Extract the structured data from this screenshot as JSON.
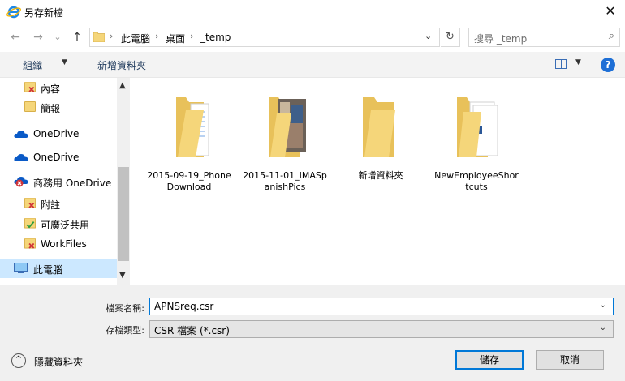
{
  "window": {
    "title": "另存新檔",
    "close": "✕"
  },
  "nav": {
    "back": "←",
    "forward": "→",
    "recent": "⌄",
    "up": "↑",
    "crumbs": [
      "此電腦",
      "桌面",
      "_temp"
    ],
    "crumb_sep": "›",
    "refresh": "↻",
    "search_placeholder": "搜尋 _temp",
    "search_icon": "⌕"
  },
  "toolbar": {
    "organize": "組織",
    "new_folder": "新增資料夾",
    "help": "?"
  },
  "sidebar": {
    "items": [
      {
        "label": "內容",
        "icon": "folder-error-icon"
      },
      {
        "label": "簡報",
        "icon": "folder-icon"
      },
      {
        "label": "OneDrive",
        "icon": "onedrive-icon"
      },
      {
        "label": "OneDrive",
        "icon": "onedrive-icon"
      },
      {
        "label": "商務用 OneDrive",
        "icon": "onedrive-business-error-icon"
      },
      {
        "label": "附註",
        "icon": "folder-error-icon"
      },
      {
        "label": "可廣泛共用",
        "icon": "folder-synced-icon"
      },
      {
        "label": "WorkFiles",
        "icon": "folder-error-icon"
      },
      {
        "label": "此電腦",
        "icon": "computer-icon"
      }
    ]
  },
  "files": [
    {
      "name": "2015-09-19_PhoneDownload",
      "line1": "2015-09-19_Phone",
      "line2": "Download",
      "kind": "folder-with-document"
    },
    {
      "name": "2015-11-01_IMASpanishPics",
      "line1": "2015-11-01_IMASp",
      "line2": "anishPics",
      "kind": "folder-with-photos"
    },
    {
      "name": "新增資料夾",
      "line1": "新增資料夾",
      "line2": "",
      "kind": "folder-empty"
    },
    {
      "name": "NewEmployeeShortcuts",
      "line1": "NewEmployeeShor",
      "line2": "tcuts",
      "kind": "folder-with-documents"
    }
  ],
  "form": {
    "filename_label": "檔案名稱:",
    "filename_value": "APNSreq.csr",
    "filetype_label": "存檔類型:",
    "filetype_value": "CSR 檔案 (*.csr)",
    "hide_folders": "隱藏資料夾",
    "save": "儲存",
    "cancel": "取消"
  },
  "colors": {
    "accent": "#0078d7",
    "folder": "#f5d67a",
    "selection": "#cce8ff",
    "onedrive": "#0a5ac7",
    "error": "#d13438",
    "synced": "#2e9e3f"
  }
}
